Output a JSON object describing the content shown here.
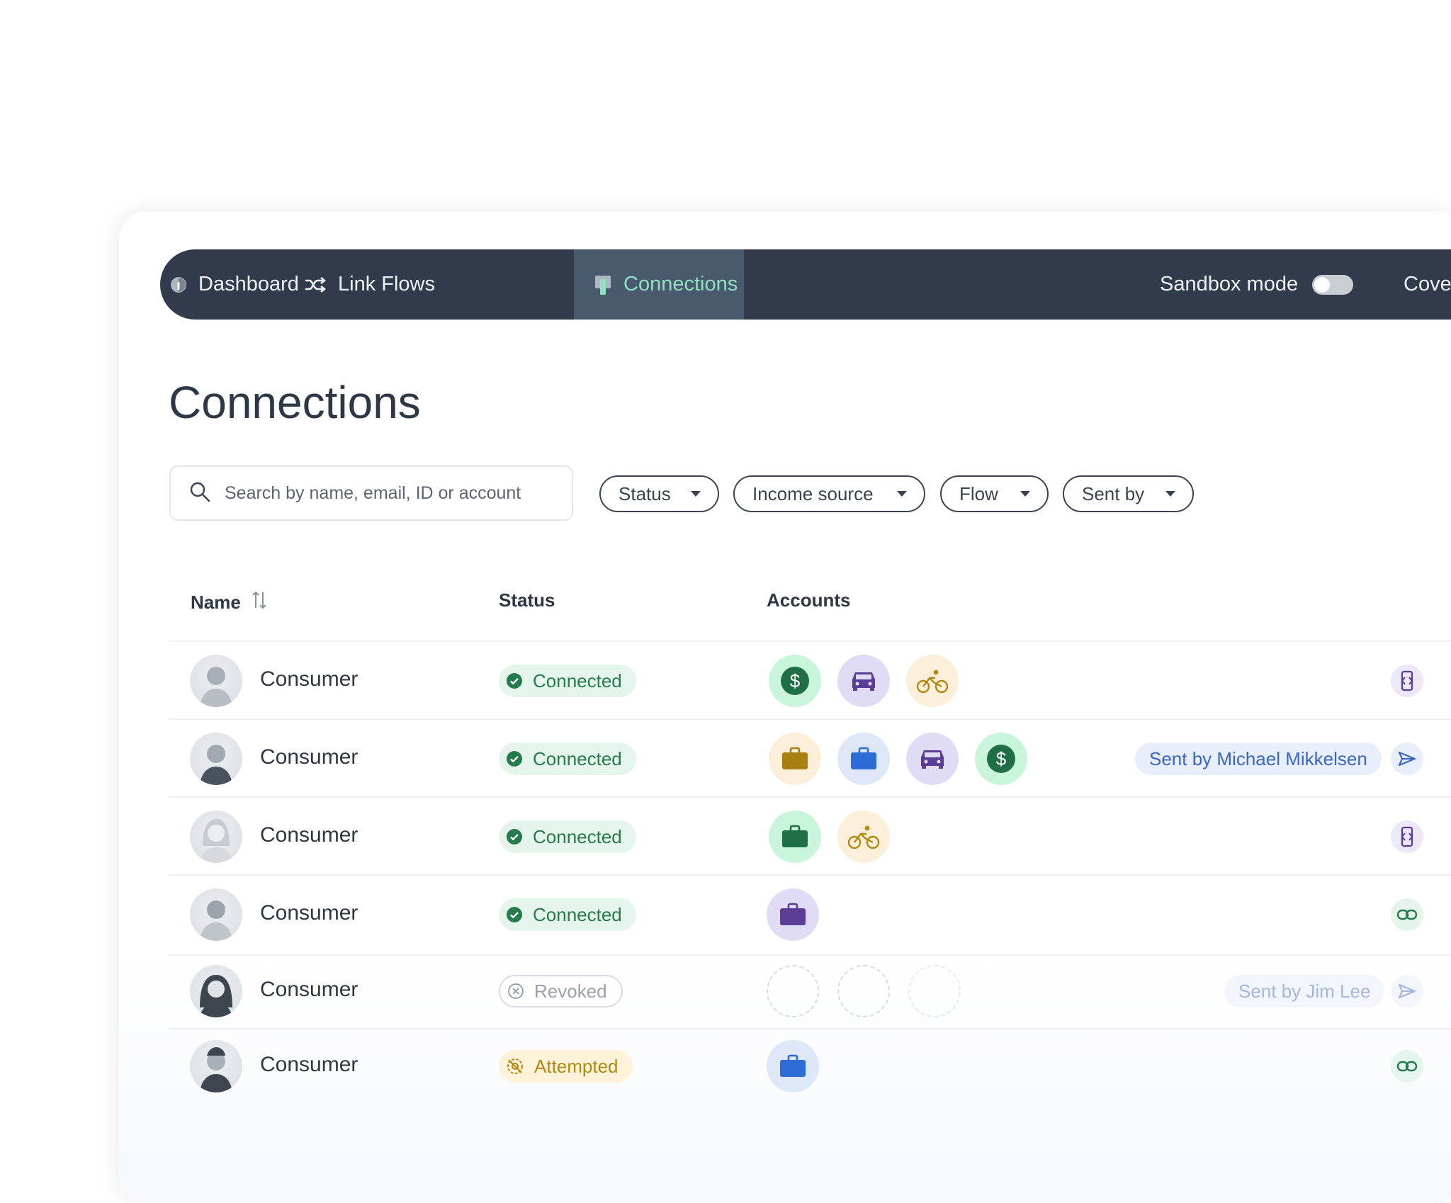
{
  "nav": {
    "items": [
      {
        "label": "Dashboard",
        "icon": "dashboard-icon"
      },
      {
        "label": "Link Flows",
        "icon": "shuffle-icon"
      },
      {
        "label": "Connections",
        "icon": "connections-icon",
        "active": true
      }
    ],
    "sandbox_label": "Sandbox mode",
    "sandbox_on": false,
    "overflow_label": "Cove"
  },
  "page": {
    "title": "Connections"
  },
  "search": {
    "placeholder": "Search by name, email, ID or account",
    "value": ""
  },
  "filters": [
    "Status",
    "Income source",
    "Flow",
    "Sent by"
  ],
  "table": {
    "columns": {
      "name": "Name",
      "status": "Status",
      "accounts": "Accounts"
    },
    "rows": [
      {
        "name": "Consumer",
        "status": "Connected",
        "accounts": [
          "dollar-icon",
          "car-icon",
          "bike-icon"
        ],
        "sent_by": "",
        "action": "mobile-sync-icon"
      },
      {
        "name": "Consumer",
        "status": "Connected",
        "accounts": [
          "briefcase-icon",
          "briefcase-icon",
          "car-icon",
          "dollar-icon"
        ],
        "sent_by": "Sent by Michael Mikkelsen",
        "action": "send-icon"
      },
      {
        "name": "Consumer",
        "status": "Connected",
        "accounts": [
          "briefcase-icon",
          "bike-icon"
        ],
        "sent_by": "",
        "action": "mobile-sync-icon"
      },
      {
        "name": "Consumer",
        "status": "Connected",
        "accounts": [
          "briefcase-icon"
        ],
        "sent_by": "",
        "action": "link-icon"
      },
      {
        "name": "Consumer",
        "status": "Revoked",
        "accounts": [
          "empty-slot",
          "empty-slot",
          "empty-slot"
        ],
        "sent_by": "Sent by Jim Lee",
        "action": "send-icon"
      },
      {
        "name": "Consumer",
        "status": "Attempted",
        "accounts": [
          "briefcase-icon"
        ],
        "sent_by": "",
        "action": "link-icon"
      }
    ]
  },
  "colors": {
    "nav_bg": "#323b4b",
    "nav_active_bg": "#4a5a6e",
    "nav_active_text": "#8fe1c0",
    "connected": "#257a4e",
    "attempted": "#b08a15",
    "revoked": "#9aa1ab",
    "sent_by_bg": "#e8eefa",
    "sent_by_text": "#3a66c4"
  }
}
